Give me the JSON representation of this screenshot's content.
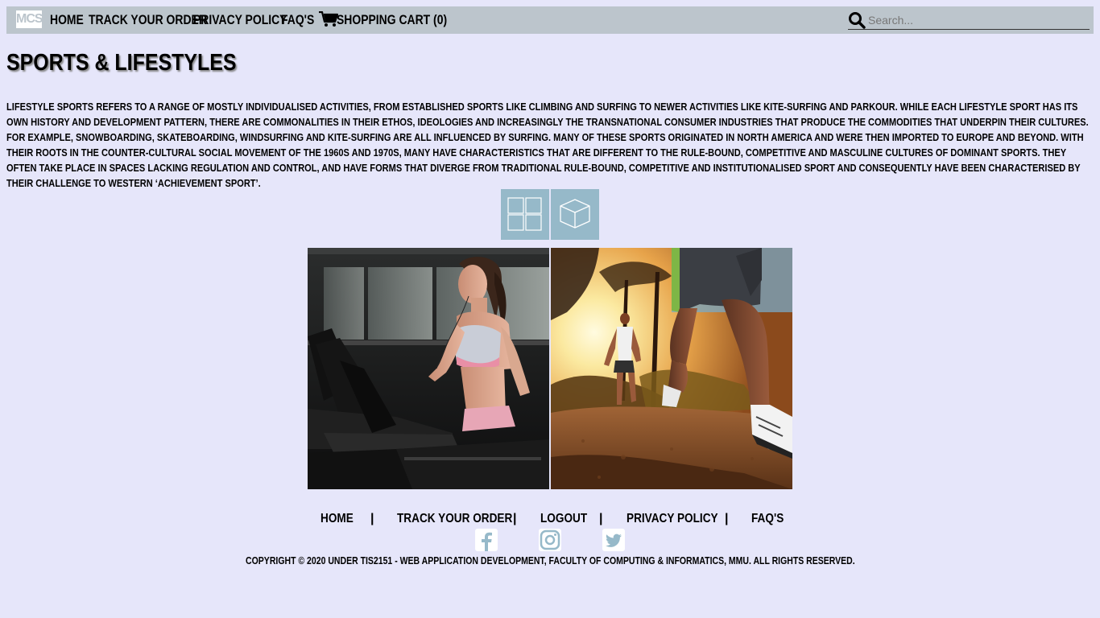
{
  "nav": {
    "logo_text": "MCS",
    "items": [
      {
        "label": "HOME"
      },
      {
        "label": "TRACK YOUR ORDER"
      },
      {
        "label": "PRIVACY POLICY"
      },
      {
        "label": "FAQ'S"
      }
    ],
    "cart_label": "SHOPPING CART (0)",
    "cart_icon": "cart-icon",
    "search": {
      "placeholder": "Search...",
      "value": "",
      "icon": "search-icon"
    }
  },
  "main": {
    "title": "SPORTS & LIFESTYLES",
    "intro": "LIFESTYLE SPORTS REFERS TO A RANGE OF MOSTLY INDIVIDUALISED ACTIVITIES, FROM ESTABLISHED SPORTS LIKE CLIMBING AND SURFING TO NEWER ACTIVITIES LIKE KITE-SURFING AND PARKOUR. WHILE EACH LIFESTYLE SPORT HAS ITS OWN HISTORY AND DEVELOPMENT PATTERN, THERE ARE COMMONALITIES IN THEIR ETHOS, IDEOLOGIES AND INCREASINGLY THE TRANSNATIONAL CONSUMER INDUSTRIES THAT PRODUCE THE COMMODITIES THAT UNDERPIN THEIR CULTURES. FOR EXAMPLE, SNOWBOARDING, SKATEBOARDING, WINDSURFING AND KITE-SURFING ARE ALL INFLUENCED BY SURFING. MANY OF THESE SPORTS ORIGINATED IN NORTH AMERICA AND WERE THEN IMPORTED TO EUROPE AND BEYOND. WITH THEIR ROOTS IN THE COUNTER-CULTURAL SOCIAL MOVEMENT OF THE 1960S AND 1970S, MANY HAVE CHARACTERISTICS THAT ARE DIFFERENT TO THE RULE-BOUND, COMPETITIVE AND MASCULINE CULTURES OF DOMINANT SPORTS. THEY OFTEN TAKE PLACE IN SPACES LACKING REGULATION AND CONTROL, AND HAVE FORMS THAT DIVERGE FROM TRADITIONAL RULE-BOUND, COMPETITIVE AND INSTITUTIONALISED SPORT AND CONSEQUENTLY HAVE BEEN CHARACTERISED BY THEIR CHALLENGE TO WESTERN ‘ACHIEVEMENT SPORT’.",
    "view_buttons": [
      {
        "icon": "grid-view-icon"
      },
      {
        "icon": "cube-view-icon"
      }
    ],
    "photos": [
      {
        "subject": "woman-treadmill"
      },
      {
        "subject": "trail-runners"
      }
    ]
  },
  "footer": {
    "links": [
      {
        "label": "HOME"
      },
      {
        "label": "TRACK YOUR ORDER"
      },
      {
        "label": "LOGOUT"
      },
      {
        "label": "PRIVACY POLICY"
      },
      {
        "label": "FAQ'S"
      }
    ],
    "separator": "|",
    "social": [
      {
        "icon": "facebook-icon"
      },
      {
        "icon": "instagram-icon"
      },
      {
        "icon": "twitter-icon"
      }
    ],
    "copyright": "COPYRIGHT © 2020 UNDER TIS2151 - WEB APPLICATION DEVELOPMENT, FACULTY OF COMPUTING & INFORMATICS, MMU. ALL RIGHTS RESERVED."
  },
  "colors": {
    "page_bg": "#e6e6fa",
    "navbar_bg": "#bcc5cc",
    "accent": "#96b9c9"
  }
}
